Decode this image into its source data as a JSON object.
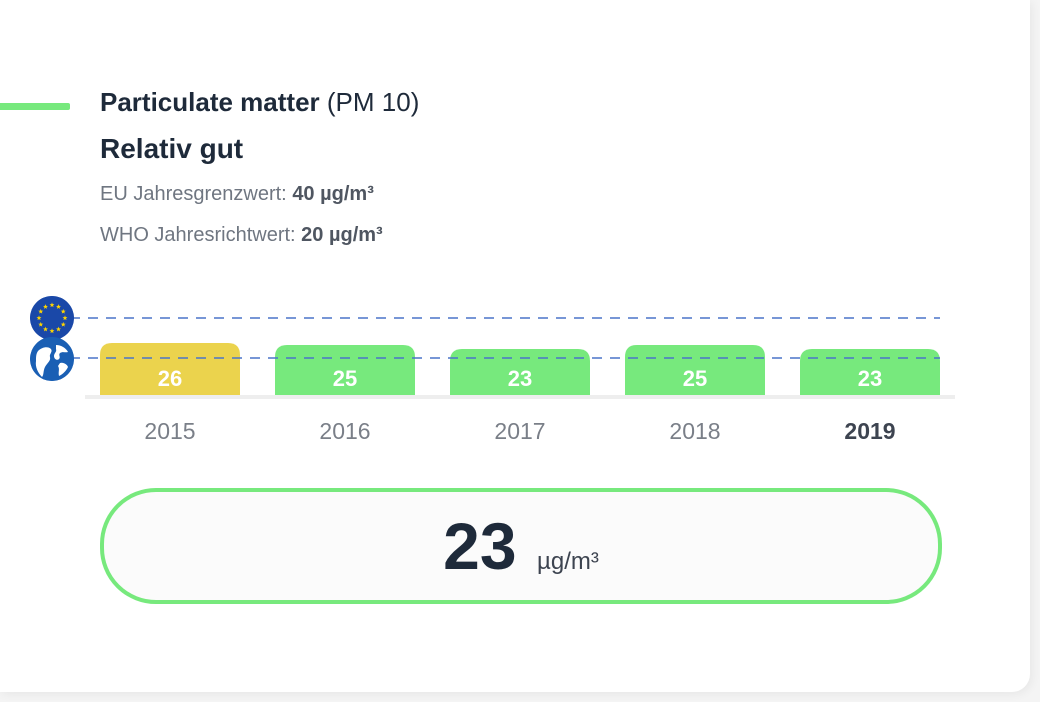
{
  "pollutant": {
    "name": "Particulate matter",
    "code": "(PM 10)",
    "rating": "Relativ gut",
    "status_color": "#77e97d"
  },
  "limits": {
    "eu_label": "EU Jahresgrenzwert:",
    "eu_value": "40",
    "who_label": "WHO Jahresrichtwert:",
    "who_value": "20",
    "unit": "µg/m³"
  },
  "icons": {
    "eu": "eu-flag-icon",
    "who": "globe-icon"
  },
  "current": {
    "value": "23",
    "unit": "µg/m³"
  },
  "chart_data": {
    "type": "bar",
    "categories": [
      "2015",
      "2016",
      "2017",
      "2018",
      "2019"
    ],
    "values": [
      26,
      25,
      23,
      25,
      23
    ],
    "bar_colors": [
      "#ebd34d",
      "#77e97d",
      "#77e97d",
      "#77e97d",
      "#77e97d"
    ],
    "highlighted_category": "2019",
    "reference_lines": [
      {
        "name": "EU",
        "value": 40
      },
      {
        "name": "WHO",
        "value": 20
      }
    ],
    "grid": false,
    "legend": "none"
  }
}
